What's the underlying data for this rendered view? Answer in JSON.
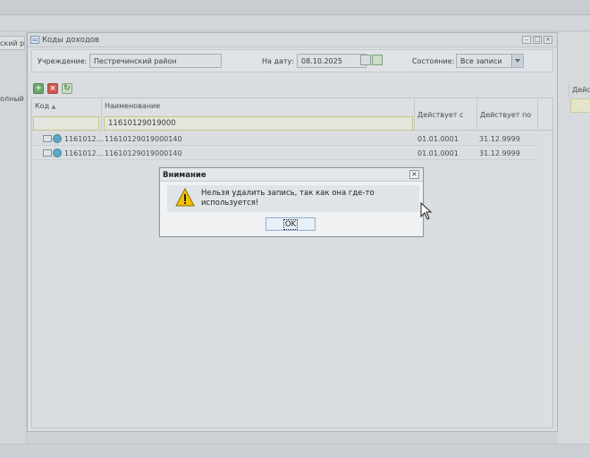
{
  "background": {
    "left_tab_label": "ский ра",
    "left_side_label": "олный",
    "right_header_label": "Дейст"
  },
  "window": {
    "title": "Коды доходов",
    "controls": {
      "minimize": "–",
      "maximize": "□",
      "close": "×"
    }
  },
  "filters": {
    "institution_label": "Учреждение:",
    "institution_value": "Пестречинский район",
    "date_label": "На дату:",
    "date_value": "08.10.2025",
    "state_label": "Состояние:",
    "state_value": "Все записи"
  },
  "grid": {
    "columns": [
      "Код",
      "Наименование",
      "Действует с",
      "Действует по"
    ],
    "sort_indicator": "▲",
    "filter_code": "",
    "filter_name": "11610129019000",
    "rows": [
      {
        "code": "1161012…",
        "name": "11610129019000140",
        "from": "01.01.0001",
        "to": "31.12.9999"
      },
      {
        "code": "1161012…",
        "name": "11610129019000140",
        "from": "01.01.0001",
        "to": "31.12.9999"
      }
    ]
  },
  "dialog": {
    "title": "Внимание",
    "close_glyph": "×",
    "message": "Нельзя удалить запись, так как она где-то используется!",
    "ok_label": "OK"
  },
  "colors": {
    "accent_filter_border": "#c8ca7e",
    "warning_yellow": "#f2c200",
    "add_button": "#4caf50",
    "delete_button": "#d9433a"
  }
}
